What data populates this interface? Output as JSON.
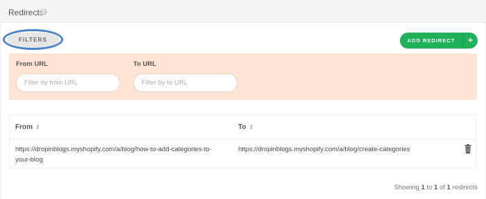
{
  "header": {
    "title": "Redirects",
    "help_icon": "question-circle-icon"
  },
  "toolbar": {
    "filters_label": "FILTERS",
    "add_redirect_label": "ADD REDIRECT",
    "add_icon": "plus-icon",
    "accent": "#1fb25a"
  },
  "filters": {
    "from_label": "From URL",
    "from_placeholder": "Filter by from URL",
    "from_value": "",
    "to_label": "To URL",
    "to_placeholder": "Filter by to URL",
    "to_value": "",
    "panel_color": "#fde4d4"
  },
  "table": {
    "columns": [
      "From",
      "To"
    ],
    "sort_icon": "sort-icon",
    "rows": [
      {
        "from": "https://dropinblogs.myshopify.com/a/blog/how-to-add-categories-to-your-blog",
        "to": "https://dropinblogs.myshopify.com/a/blog/create-categories",
        "action_icon": "trash-icon"
      }
    ]
  },
  "pagination": {
    "prefix": "Showing",
    "start": "1",
    "to_word": "to",
    "end": "1",
    "of_word": "of",
    "total": "1",
    "suffix": "redirects"
  }
}
